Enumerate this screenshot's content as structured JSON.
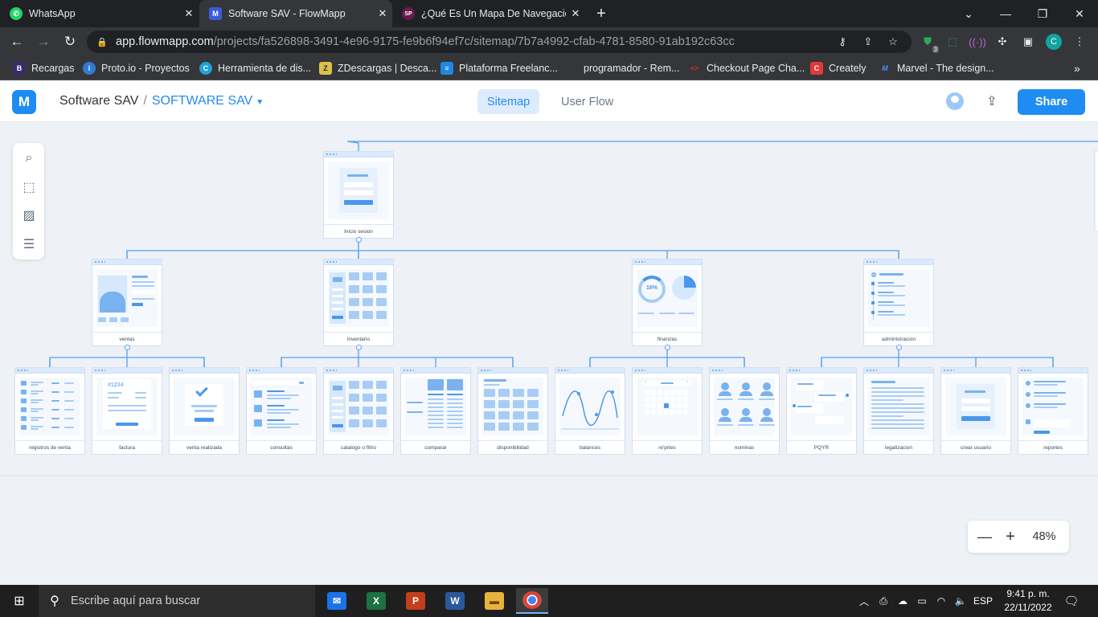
{
  "browser": {
    "tabs": [
      {
        "title": "WhatsApp",
        "icon": "whatsapp-icon",
        "color": "#25d366",
        "glyph": "✆",
        "active": false
      },
      {
        "title": "Software SAV - FlowMapp",
        "icon": "flowmapp-icon",
        "color": "#3b5bdb",
        "glyph": "M",
        "active": true
      },
      {
        "title": "¿Qué Es Un Mapa De Navegación",
        "icon": "sp-icon",
        "color": "#6a1b4d",
        "glyph": "SP",
        "active": false
      }
    ],
    "url_domain": "app.flowmapp.com",
    "url_path": "/projects/fa526898-3491-4e96-9175-fe9b6f94ef7c/sitemap/7b7a4992-cfab-4781-8580-91ab192c63cc",
    "extension_badge": "3",
    "profile_initial": "C",
    "bookmarks": [
      {
        "label": "Recargas",
        "icon": "b-icon",
        "color": "#3b2a6b",
        "glyph": "B"
      },
      {
        "label": "Proto.io - Proyectos",
        "icon": "protoio-icon",
        "color": "#2f7bd6",
        "glyph": "i"
      },
      {
        "label": "Herramienta de dis...",
        "icon": "canva-icon",
        "color": "#1fa2d6",
        "glyph": "C"
      },
      {
        "label": "ZDescargas | Desca...",
        "icon": "z-icon",
        "color": "#d8c24a",
        "glyph": "Z"
      },
      {
        "label": "Plataforma Freelanc...",
        "icon": "freelance-icon",
        "color": "#1e88e5",
        "glyph": "≡"
      },
      {
        "label": "programador - Rem...",
        "icon": "blank-icon",
        "color": "#35363a",
        "glyph": ""
      },
      {
        "label": "Checkout Page Cha...",
        "icon": "checkout-icon",
        "color": "#d93025",
        "glyph": "<>"
      },
      {
        "label": "Creately",
        "icon": "creately-icon",
        "color": "#e53935",
        "glyph": "C"
      },
      {
        "label": "Marvel - The design...",
        "icon": "marvel-icon",
        "color": "#1e6ff0",
        "glyph": "M"
      }
    ]
  },
  "app": {
    "project": "Software SAV",
    "sitemap": "SOFTWARE SAV",
    "tab_sitemap": "Sitemap",
    "tab_userflow": "User Flow",
    "share_label": "Share",
    "zoom_level": "48%"
  },
  "sitemap": {
    "root": {
      "label": "Inicio sesion",
      "kind": "login"
    },
    "sections": [
      {
        "label": "ventas",
        "kind": "ventas",
        "children": [
          {
            "label": "registros de venta",
            "kind": "rows"
          },
          {
            "label": "factura",
            "kind": "invoice",
            "invoice_no": "#1234"
          },
          {
            "label": "venta realizada",
            "kind": "check"
          }
        ]
      },
      {
        "label": "inventario",
        "kind": "catalog",
        "children": [
          {
            "label": "consultas",
            "kind": "search"
          },
          {
            "label": "catalogo o filtro",
            "kind": "catalog"
          },
          {
            "label": "comparar",
            "kind": "compare"
          },
          {
            "label": "disponibilidad",
            "kind": "grid"
          }
        ]
      },
      {
        "label": "finanzas",
        "kind": "finance",
        "pct": "16%",
        "children": [
          {
            "label": "balances",
            "kind": "wave"
          },
          {
            "label": "re'prtes",
            "kind": "calendar"
          },
          {
            "label": "nominas",
            "kind": "people"
          }
        ]
      },
      {
        "label": "administracion",
        "kind": "admin",
        "children": [
          {
            "label": "PQYR",
            "kind": "chat"
          },
          {
            "label": "legalizacion",
            "kind": "text"
          },
          {
            "label": "crear usuario",
            "kind": "login"
          },
          {
            "label": "reportes",
            "kind": "list"
          }
        ]
      }
    ]
  },
  "taskbar": {
    "search_placeholder": "Escribe aquí para buscar",
    "apps": [
      {
        "name": "mail-app-icon",
        "color": "#1a73e8",
        "glyph": "✉"
      },
      {
        "name": "excel-app-icon",
        "color": "#1e7145",
        "glyph": "X"
      },
      {
        "name": "powerpoint-app-icon",
        "color": "#c43e1c",
        "glyph": "P"
      },
      {
        "name": "word-app-icon",
        "color": "#2b579a",
        "glyph": "W"
      },
      {
        "name": "explorer-app-icon",
        "color": "#e8b33a",
        "glyph": "▬"
      },
      {
        "name": "chrome-app-icon",
        "color": "#db4437",
        "glyph": "●"
      }
    ],
    "language": "ESP",
    "time": "9:41 p. m.",
    "date": "22/11/2022"
  }
}
